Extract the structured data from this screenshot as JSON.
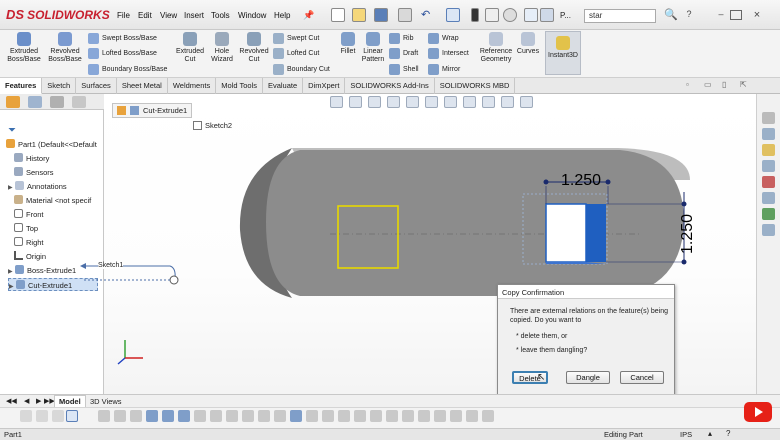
{
  "app": {
    "brand": "SOLIDWORKS",
    "brand_prefix": "DS",
    "search_value": "star",
    "search_placeholder": "Search"
  },
  "menu": [
    "File",
    "Edit",
    "View",
    "Insert",
    "Tools",
    "Window",
    "Help"
  ],
  "quick_access": {
    "truncated_label": "P..."
  },
  "command_manager": {
    "extruded_boss": "Extruded Boss/Base",
    "revolved_boss": "Revolved Boss/Base",
    "swept_boss": "Swept Boss/Base",
    "lofted_boss": "Lofted Boss/Base",
    "boundary_boss": "Boundary Boss/Base",
    "extruded_cut": "Extruded Cut",
    "hole_wizard": "Hole Wizard",
    "revolved_cut": "Revolved Cut",
    "swept_cut": "Swept Cut",
    "lofted_cut": "Lofted Cut",
    "boundary_cut": "Boundary Cut",
    "fillet": "Fillet",
    "linear_pattern": "Linear Pattern",
    "rib": "Rib",
    "draft": "Draft",
    "shell": "Shell",
    "wrap": "Wrap",
    "intersect": "Intersect",
    "mirror": "Mirror",
    "reference_geometry": "Reference Geometry",
    "curves": "Curves",
    "instant3d": "Instant3D"
  },
  "tabs": [
    "Features",
    "Sketch",
    "Surfaces",
    "Sheet Metal",
    "Weldments",
    "Mold Tools",
    "Evaluate",
    "DimXpert",
    "SOLIDWORKS Add-Ins",
    "SOLIDWORKS MBD"
  ],
  "feature_tree": {
    "part": "Part1  (Default<<Default",
    "items": [
      "History",
      "Sensors",
      "Annotations",
      "Material <not specif",
      "Front",
      "Top",
      "Right",
      "Origin",
      "Boss-Extrude1",
      "Cut-Extrude1"
    ]
  },
  "breadcrumb": {
    "feature": "Cut-Extrude1",
    "sketch": "Sketch2"
  },
  "graphics": {
    "sketch_callout": "Sketch1",
    "dim_horizontal": "1.250",
    "dim_vertical": "1.250"
  },
  "dialog": {
    "title": "Copy Confirmation",
    "message": "There are external relations on the feature(s) being copied.  Do you want to",
    "option1": "* delete them, or",
    "option2": "* leave them dangling?",
    "btn_delete": "Delete",
    "btn_dangle": "Dangle",
    "btn_cancel": "Cancel"
  },
  "bottom_tabs": [
    "Model",
    "3D Views"
  ],
  "status": {
    "left": "Part1",
    "mode": "Editing Part",
    "units": "IPS"
  },
  "colors": {
    "brand_red": "#c8202f",
    "part_grey": "#8a8a8a",
    "sketch_yellow": "#e6d800",
    "face_blue": "#1f5fc0",
    "dim_navy": "#1a2a6c"
  }
}
